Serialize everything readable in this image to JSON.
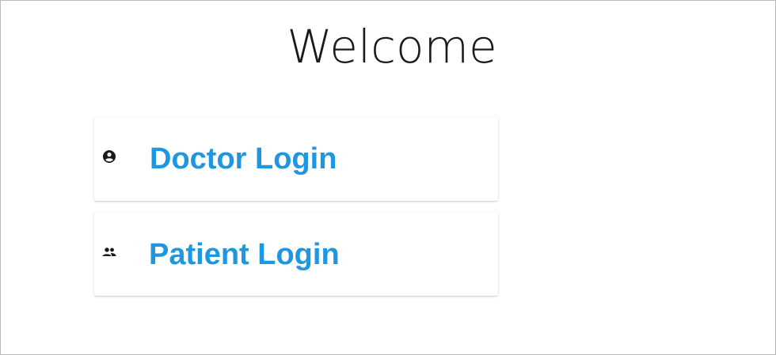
{
  "page": {
    "title": "Welcome"
  },
  "login_options": [
    {
      "label": "Doctor Login",
      "icon": "account-circle-icon"
    },
    {
      "label": "Patient Login",
      "icon": "people-icon"
    }
  ],
  "colors": {
    "accent": "#1f97e0",
    "title_text": "#1a1a1a",
    "icon": "#1a1a1a",
    "border": "#b9b9b9"
  }
}
